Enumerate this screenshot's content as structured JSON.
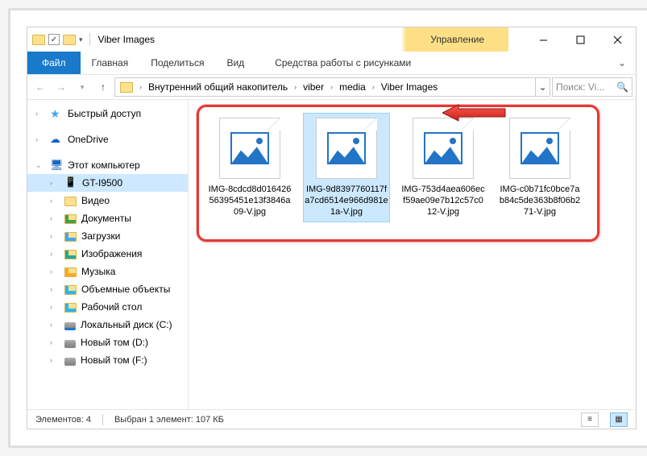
{
  "title": "Viber Images",
  "context_tab": "Управление",
  "tabs": {
    "file": "Файл",
    "home": "Главная",
    "share": "Поделиться",
    "view": "Вид",
    "ctx": "Средства работы с рисунками"
  },
  "breadcrumbs": [
    "Внутренний общий накопитель",
    "viber",
    "media",
    "Viber Images"
  ],
  "search_placeholder": "Поиск: Vi...",
  "nav": {
    "quick": "Быстрый доступ",
    "onedrive": "OneDrive",
    "thispc": "Этот компьютер",
    "device": "GT-I9500",
    "video": "Видео",
    "docs": "Документы",
    "downloads": "Загрузки",
    "pictures": "Изображения",
    "music": "Музыка",
    "objects3d": "Объемные объекты",
    "desktop": "Рабочий стол",
    "cdisk": "Локальный диск (C:)",
    "ddisk": "Новый том (D:)",
    "fdisk": "Новый том (F:)"
  },
  "files": [
    {
      "name": "IMG-8cdcd8d01642656395451e13f3846a09-V.jpg",
      "selected": false
    },
    {
      "name": "IMG-9d8397760117fa7cd6514e966d981e1a-V.jpg",
      "selected": true
    },
    {
      "name": "IMG-753d4aea606ecf59ae09e7b12c57c012-V.jpg",
      "selected": false
    },
    {
      "name": "IMG-c0b71fc0bce7ab84c5de363b8f06b271-V.jpg",
      "selected": false
    }
  ],
  "status": {
    "count": "Элементов: 4",
    "selection": "Выбран 1 элемент: 107 КБ"
  }
}
